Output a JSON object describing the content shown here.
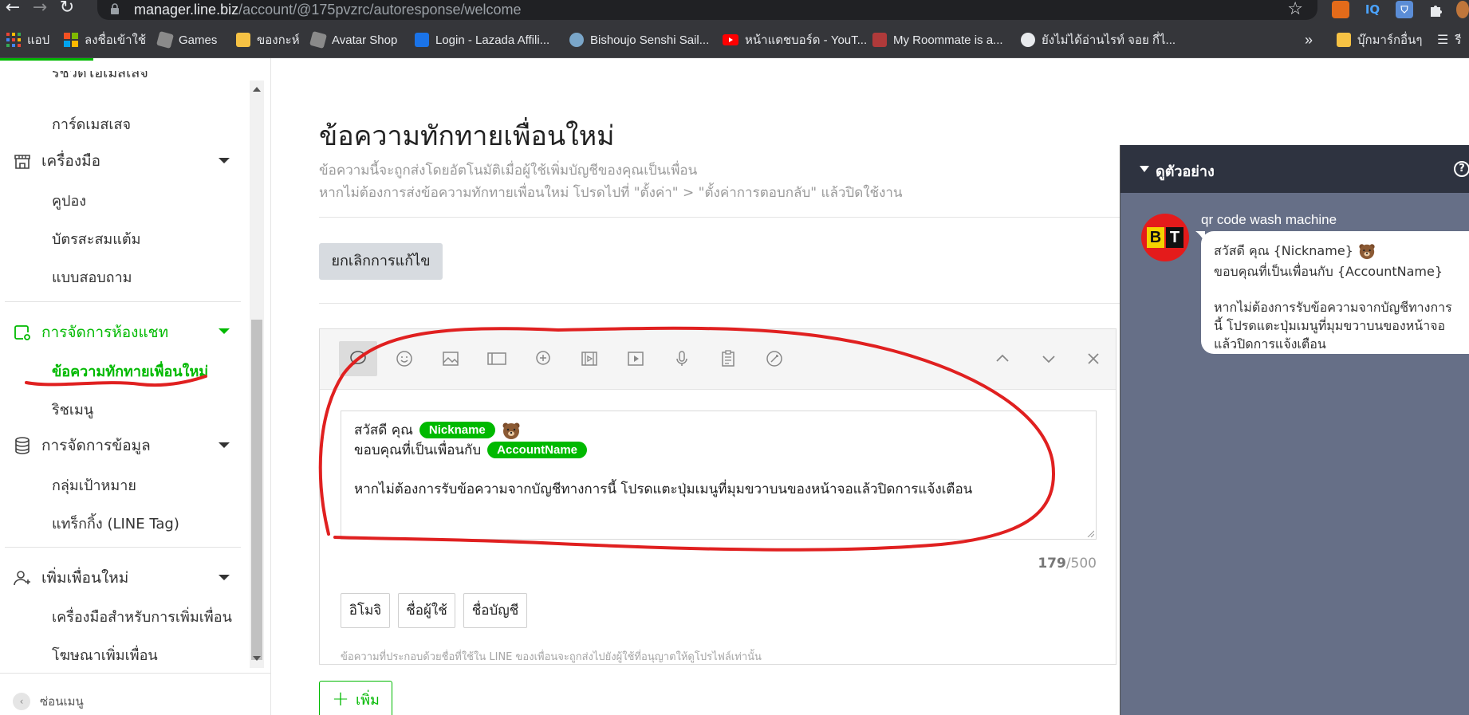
{
  "browser": {
    "url_host": "manager.line.biz",
    "url_path": "/account/@175pvzrc/autoresponse/welcome",
    "ext_iq": "IQ",
    "bookmarks": [
      {
        "label": "แอป"
      },
      {
        "label": "ลงชื่อเข้าใช้"
      },
      {
        "label": "Games"
      },
      {
        "label": "ของกะห์"
      },
      {
        "label": "Avatar Shop"
      },
      {
        "label": "Login - Lazada Affili..."
      },
      {
        "label": "Bishoujo Senshi Sail..."
      },
      {
        "label": "หน้าแดชบอร์ด - YouT..."
      },
      {
        "label": "My Roommate is a..."
      },
      {
        "label": "ยังไม่ได้อ่านไรท์ จอย กี่ไ..."
      }
    ],
    "more_label": "»",
    "other_bookmarks": "บุ๊กมาร์กอื่นๆ",
    "reading_list": "รี"
  },
  "sidebar": {
    "partial_item": "ริชวิดีโอเมสเสจ",
    "items": {
      "card_message": "การ์ดเมสเสจ",
      "tools": "เครื่องมือ",
      "coupon": "คูปอง",
      "reward_card": "บัตรสะสมแต้ม",
      "survey": "แบบสอบถาม",
      "chat_mgmt": "การจัดการห้องแชท",
      "welcome_msg": "ข้อความทักทายเพื่อนใหม่",
      "rich_menu": "ริชเมนู",
      "data_mgmt": "การจัดการข้อมูล",
      "audience": "กลุ่มเป้าหมาย",
      "tracking": "แทร็กกิ้ง (LINE Tag)",
      "add_friends": "เพิ่มเพื่อนใหม่",
      "friend_tools": "เครื่องมือสำหรับการเพิ่มเพื่อน",
      "friend_ads": "โฆษณาเพิ่มเพื่อน"
    },
    "hide_menu": "ซ่อนเมนู"
  },
  "main": {
    "title": "ข้อความทักทายเพื่อนใหม่",
    "desc1": "ข้อความนี้จะถูกส่งโดยอัตโนมัติเมื่อผู้ใช้เพิ่มบัญชีของคุณเป็นเพื่อน",
    "desc2": "หากไม่ต้องการส่งข้อความทักทายเพื่อนใหม่ โปรดไปที่ \"ตั้งค่า\" > \"ตั้งค่าการตอบกลับ\" แล้วปิดใช้งาน",
    "cancel_edit": "ยกเลิกการแก้ไข",
    "message": {
      "line1_text": "สวัสดี คุณ",
      "line1_chip": "Nickname",
      "line2_text": "ขอบคุณที่เป็นเพื่อนกับ",
      "line2_chip": "AccountName",
      "line4_text": "หากไม่ต้องการรับข้อความจากบัญชีทางการนี้ โปรดแตะปุ่มเมนูที่มุมขวาบนของหน้าจอแล้วปิดการแจ้งเตือน"
    },
    "char_count": "179",
    "char_max": "/500",
    "insert_buttons": {
      "emoji": "อิโมจิ",
      "username": "ชื่อผู้ใช้",
      "account_name": "ชื่อบัญชี"
    },
    "note": "ข้อความที่ประกอบด้วยชื่อที่ใช้ใน LINE ของเพื่อนจะถูกส่งไปยังผู้ใช้ที่อนุญาตให้ดูโปรไฟล์เท่านั้น",
    "add_label": "เพิ่ม"
  },
  "preview": {
    "title": "ดูตัวอย่าง",
    "help": "?",
    "account_name": "qr code wash machine",
    "avatar_letters": [
      "B",
      "T"
    ],
    "bubble": {
      "line1": "สวัสดี คุณ {Nickname}",
      "line2": "ขอบคุณที่เป็นเพื่อนกับ {AccountName}",
      "line3": "หากไม่ต้องการรับข้อความจากบัญชีทางการ",
      "line4": "นี้ โปรดแตะปุ่มเมนูที่มุมขวาบนของหน้าจอ",
      "line5": "แล้วปิดการแจ้งเตือน"
    }
  },
  "colors": {
    "line_green": "#00b900",
    "preview_bg": "#666f87",
    "annotation_red": "#e02020"
  }
}
